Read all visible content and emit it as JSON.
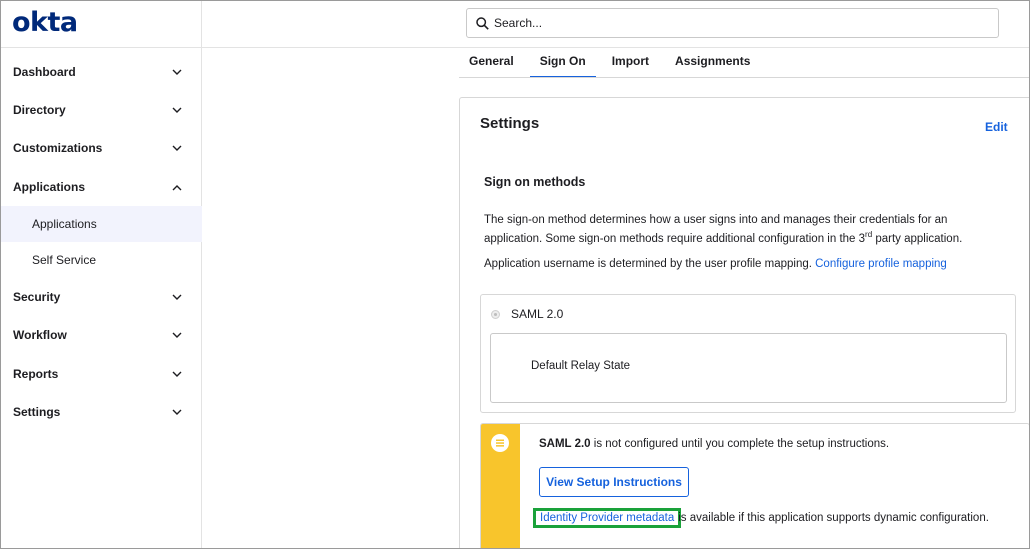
{
  "brand": {
    "logo_text": "okta",
    "logo_color": "#00297a",
    "accent": "#1662dd",
    "highlight": "#1aa23a",
    "warning": "#f8c52c"
  },
  "search": {
    "placeholder": "Search..."
  },
  "sidebar": {
    "items": [
      {
        "label": "Dashboard",
        "icon": "chevron-down-icon"
      },
      {
        "label": "Directory",
        "icon": "chevron-down-icon"
      },
      {
        "label": "Customizations",
        "icon": "chevron-down-icon"
      },
      {
        "label": "Applications",
        "icon": "chevron-up-icon",
        "expanded": true,
        "children": [
          {
            "label": "Applications",
            "active": true
          },
          {
            "label": "Self Service"
          }
        ]
      },
      {
        "label": "Security",
        "icon": "chevron-down-icon"
      },
      {
        "label": "Workflow",
        "icon": "chevron-down-icon"
      },
      {
        "label": "Reports",
        "icon": "chevron-down-icon"
      },
      {
        "label": "Settings",
        "icon": "chevron-down-icon"
      }
    ]
  },
  "tabs": [
    {
      "label": "General"
    },
    {
      "label": "Sign On",
      "active": true
    },
    {
      "label": "Import"
    },
    {
      "label": "Assignments"
    }
  ],
  "settings": {
    "title": "Settings",
    "edit_label": "Edit",
    "section_title": "Sign on methods",
    "desc_part1": "The sign-on method determines how a user signs into and manages their credentials for an application. Some sign-on methods require additional configuration in the 3",
    "desc_sup": "rd",
    "desc_part2": " party application.",
    "username_text": "Application username is determined by the user profile mapping. ",
    "username_link": "Configure profile mapping",
    "saml_option": "SAML 2.0",
    "relay_label": "Default Relay State",
    "callout": {
      "bold": "SAML 2.0",
      "text": " is not configured until you complete the setup instructions.",
      "button_label": "View Setup Instructions",
      "metadata_link": "Identity Provider metadata",
      "metadata_rest": " is available if this application supports dynamic configuration."
    }
  }
}
